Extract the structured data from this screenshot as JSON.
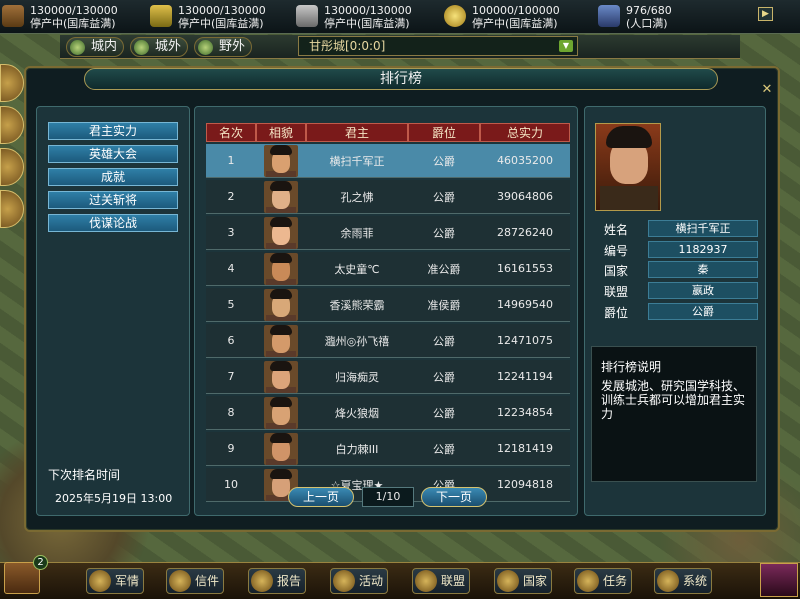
{
  "top_resources": [
    {
      "icon": "wood-icon",
      "value": "130000/130000",
      "status": "停产中(国库益满)"
    },
    {
      "icon": "grain-icon",
      "value": "130000/130000",
      "status": "停产中(国库益满)"
    },
    {
      "icon": "iron-icon",
      "value": "130000/130000",
      "status": "停产中(国库益满)"
    },
    {
      "icon": "coin-icon",
      "value": "100000/100000",
      "status": "停产中(国库益满)"
    },
    {
      "icon": "population-icon",
      "value": "976/680",
      "status": "(人口满)"
    }
  ],
  "nav": {
    "tabs": [
      {
        "label": "城内"
      },
      {
        "label": "城外"
      },
      {
        "label": "野外"
      }
    ],
    "city": "甘彤城[0:0:0]"
  },
  "panel": {
    "title": "排行榜"
  },
  "left_menu": [
    "君主实力",
    "英雄大会",
    "成就",
    "过关斩将",
    "伐谋论战"
  ],
  "next_rank": {
    "label": "下次排名时间",
    "value": "2025年5月19日  13:00"
  },
  "table": {
    "headers": [
      "名次",
      "相貌",
      "君主",
      "爵位",
      "总实力"
    ],
    "rows": [
      {
        "rank": "1",
        "name": "横扫千军正",
        "title": "公爵",
        "power": "46035200"
      },
      {
        "rank": "2",
        "name": "孔之怫",
        "title": "公爵",
        "power": "39064806"
      },
      {
        "rank": "3",
        "name": "余雨菲",
        "title": "公爵",
        "power": "28726240"
      },
      {
        "rank": "4",
        "name": "太史童℃",
        "title": "准公爵",
        "power": "16161553"
      },
      {
        "rank": "5",
        "name": "香溪熊荣霸",
        "title": "准侯爵",
        "power": "14969540"
      },
      {
        "rank": "6",
        "name": "瀶州◎孙飞禧",
        "title": "公爵",
        "power": "12471075"
      },
      {
        "rank": "7",
        "name": "归海痴灵",
        "title": "公爵",
        "power": "12241194"
      },
      {
        "rank": "8",
        "name": "烽火狼烟",
        "title": "公爵",
        "power": "12234854"
      },
      {
        "rank": "9",
        "name": "白力棘III",
        "title": "公爵",
        "power": "12181419"
      },
      {
        "rank": "10",
        "name": "☆夏宝理★",
        "title": "公爵",
        "power": "12094818"
      }
    ]
  },
  "pager": {
    "prev": "上一页",
    "page": "1/10",
    "next": "下一页"
  },
  "detail": {
    "fields": [
      {
        "key": "姓名",
        "value": "横扫千军正"
      },
      {
        "key": "编号",
        "value": "1182937"
      },
      {
        "key": "国家",
        "value": "秦"
      },
      {
        "key": "联盟",
        "value": "嬴政"
      },
      {
        "key": "爵位",
        "value": "公爵"
      }
    ],
    "desc_title": "排行榜说明",
    "desc_text": "发展城池、研究国学科技、训练士兵都可以增加君主实力"
  },
  "bottom_bar": [
    {
      "label": "军情",
      "icon": "military-icon"
    },
    {
      "label": "信件",
      "icon": "mail-icon"
    },
    {
      "label": "报告",
      "icon": "report-icon"
    },
    {
      "label": "活动",
      "icon": "event-icon"
    },
    {
      "label": "联盟",
      "icon": "alliance-icon"
    },
    {
      "label": "国家",
      "icon": "nation-icon"
    },
    {
      "label": "任务",
      "icon": "quest-icon"
    },
    {
      "label": "系统",
      "icon": "system-icon"
    }
  ],
  "chest_badge": "2"
}
